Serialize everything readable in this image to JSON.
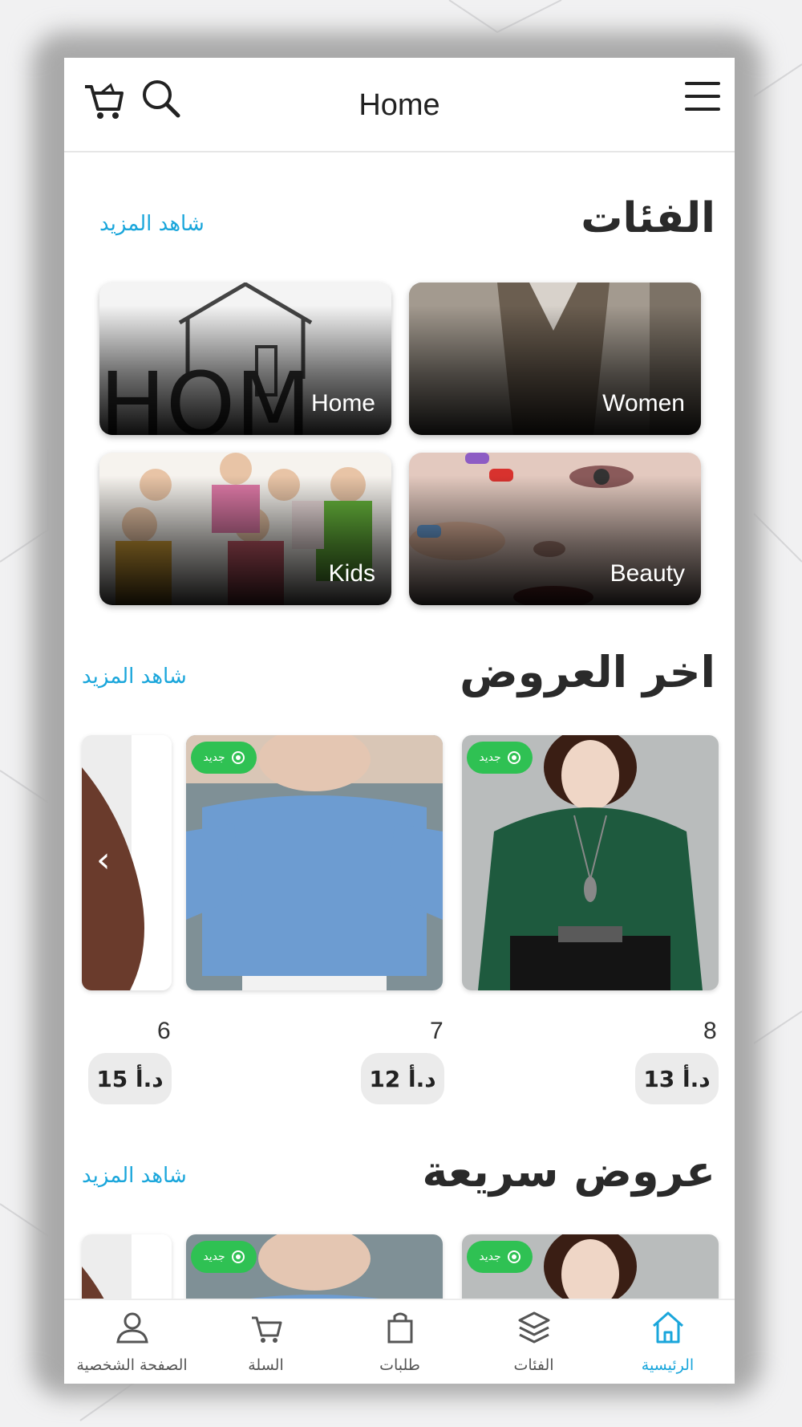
{
  "header": {
    "title": "Home",
    "icons": {
      "cart": "cart-icon",
      "search": "search-icon",
      "menu": "menu-icon"
    }
  },
  "categories_section": {
    "title": "الفئات",
    "see_more": "شاهد المزيد",
    "tiles": [
      {
        "label": "Women"
      },
      {
        "label": "Home"
      },
      {
        "label": "Beauty"
      },
      {
        "label": "Kids"
      }
    ]
  },
  "latest_offers": {
    "title": "اخر العروض",
    "see_more": "شاهد المزيد",
    "products": [
      {
        "name": "8",
        "price": "13 د.أ",
        "badge": "جديد"
      },
      {
        "name": "7",
        "price": "12 د.أ",
        "badge": "جديد"
      },
      {
        "name": "6",
        "price": "15 د.أ"
      }
    ]
  },
  "quick_offers": {
    "title": "عروض سريعة",
    "see_more": "شاهد المزيد",
    "products": [
      {
        "badge": "جديد"
      },
      {
        "badge": "جديد"
      }
    ]
  },
  "bottom_nav": {
    "items": [
      {
        "label": "الرئيسية",
        "icon": "home-icon",
        "active": true
      },
      {
        "label": "الفئات",
        "icon": "layers-icon",
        "active": false
      },
      {
        "label": "طلبات",
        "icon": "shopping-bag-icon",
        "active": false
      },
      {
        "label": "السلة",
        "icon": "cart-icon",
        "active": false
      },
      {
        "label": "الصفحة الشخصية",
        "icon": "user-icon",
        "active": false
      }
    ]
  },
  "colors": {
    "accent": "#1aa6db",
    "badge_green": "#2fc153",
    "price_bg": "#ebebeb"
  }
}
